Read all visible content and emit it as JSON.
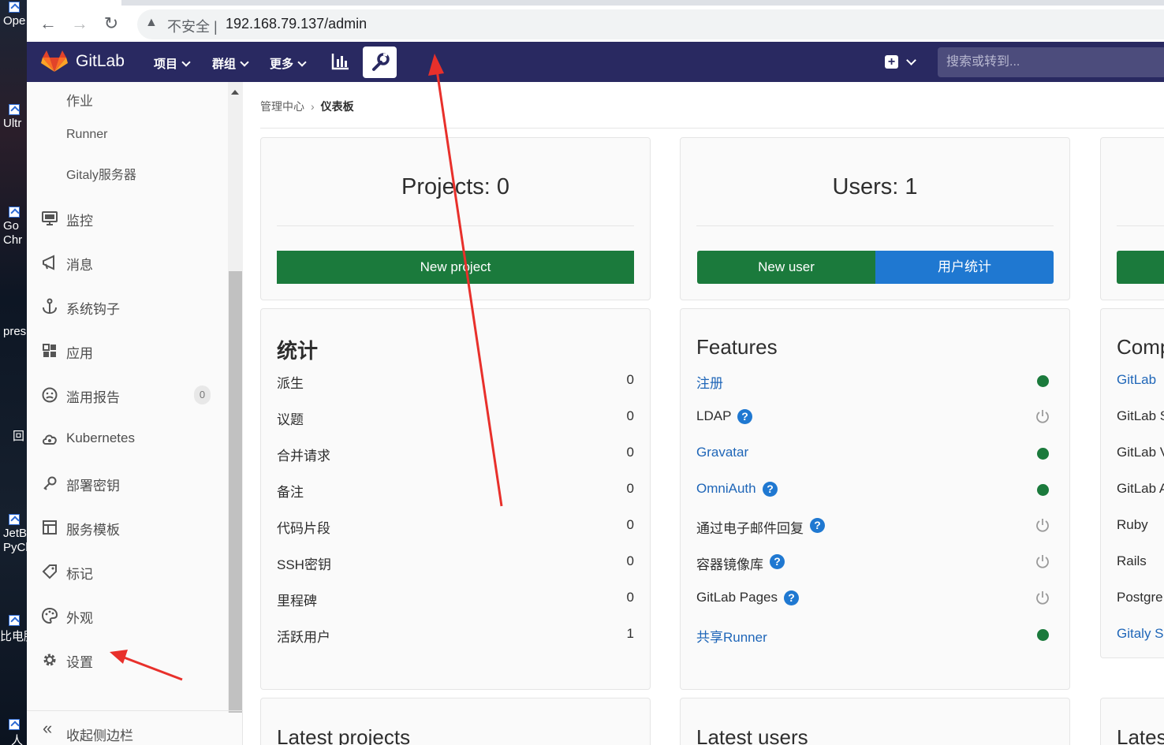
{
  "desktop": {
    "items": [
      {
        "label": "Ope"
      },
      {
        "label": "Ultr"
      },
      {
        "label": "Go Chr"
      },
      {
        "label": "pres"
      },
      {
        "label": "回"
      },
      {
        "label": "JetB PyCh"
      },
      {
        "label": "比电脑"
      },
      {
        "label": "人"
      }
    ]
  },
  "browser": {
    "insecure_label": "不安全",
    "url": "192.168.79.137/admin"
  },
  "header": {
    "brand": "GitLab",
    "nav": [
      {
        "label": "项目"
      },
      {
        "label": "群组"
      },
      {
        "label": "更多"
      }
    ],
    "search_placeholder": "搜索或转到..."
  },
  "sidebar": {
    "sub_items": [
      {
        "label": "作业"
      },
      {
        "label": "Runner"
      },
      {
        "label": "Gitaly服务器"
      }
    ],
    "items": [
      {
        "label": "监控",
        "icon": "monitor-icon"
      },
      {
        "label": "消息",
        "icon": "bullhorn-icon"
      },
      {
        "label": "系统钩子",
        "icon": "hook-icon"
      },
      {
        "label": "应用",
        "icon": "grid-icon"
      },
      {
        "label": "滥用报告",
        "icon": "sad-face-icon",
        "badge": "0"
      },
      {
        "label": "Kubernetes",
        "icon": "cloud-icon"
      },
      {
        "label": "部署密钥",
        "icon": "key-icon"
      },
      {
        "label": "服务模板",
        "icon": "template-icon"
      },
      {
        "label": "标记",
        "icon": "tag-icon"
      },
      {
        "label": "外观",
        "icon": "palette-icon"
      },
      {
        "label": "设置",
        "icon": "gear-icon"
      }
    ],
    "collapse_label": "收起侧边栏"
  },
  "breadcrumb": {
    "parent": "管理中心",
    "current": "仪表板"
  },
  "cards": {
    "projects": {
      "title": "Projects: 0",
      "button": "New project"
    },
    "users": {
      "title": "Users: 1",
      "button_new": "New user",
      "button_stats": "用户统计"
    }
  },
  "stats": {
    "title": "统计",
    "rows": [
      {
        "label": "派生",
        "value": "0"
      },
      {
        "label": "议题",
        "value": "0"
      },
      {
        "label": "合并请求",
        "value": "0"
      },
      {
        "label": "备注",
        "value": "0"
      },
      {
        "label": "代码片段",
        "value": "0"
      },
      {
        "label": "SSH密钥",
        "value": "0"
      },
      {
        "label": "里程碑",
        "value": "0"
      },
      {
        "label": "活跃用户",
        "value": "1"
      }
    ]
  },
  "features": {
    "title": "Features",
    "rows": [
      {
        "label": "注册",
        "link": true,
        "help": false,
        "status": "on"
      },
      {
        "label": "LDAP",
        "link": false,
        "help": true,
        "status": "off"
      },
      {
        "label": "Gravatar",
        "link": true,
        "help": false,
        "status": "on"
      },
      {
        "label": "OmniAuth",
        "link": true,
        "help": true,
        "status": "on"
      },
      {
        "label": "通过电子邮件回复",
        "link": false,
        "help": true,
        "status": "off"
      },
      {
        "label": "容器镜像库",
        "link": false,
        "help": true,
        "status": "off"
      },
      {
        "label": "GitLab Pages",
        "link": false,
        "help": true,
        "status": "off"
      },
      {
        "label": "共享Runner",
        "link": true,
        "help": false,
        "status": "on"
      }
    ]
  },
  "components": {
    "title": "Comp",
    "rows": [
      {
        "label": "GitLab",
        "link": true
      },
      {
        "label": "GitLab S",
        "link": false
      },
      {
        "label": "GitLab V",
        "link": false
      },
      {
        "label": "GitLab A",
        "link": false
      },
      {
        "label": "Ruby",
        "link": false
      },
      {
        "label": "Rails",
        "link": false
      },
      {
        "label": "Postgre",
        "link": false
      },
      {
        "label": "Gitaly S",
        "link": true
      }
    ]
  },
  "bottom_sections": {
    "latest_projects": "Latest projects",
    "latest_users": "Latest users",
    "latest_third": "Lates"
  },
  "colors": {
    "header_bg": "#292961",
    "green": "#1b7a3c",
    "blue": "#1f78d1",
    "annotation_red": "#e8302b"
  }
}
